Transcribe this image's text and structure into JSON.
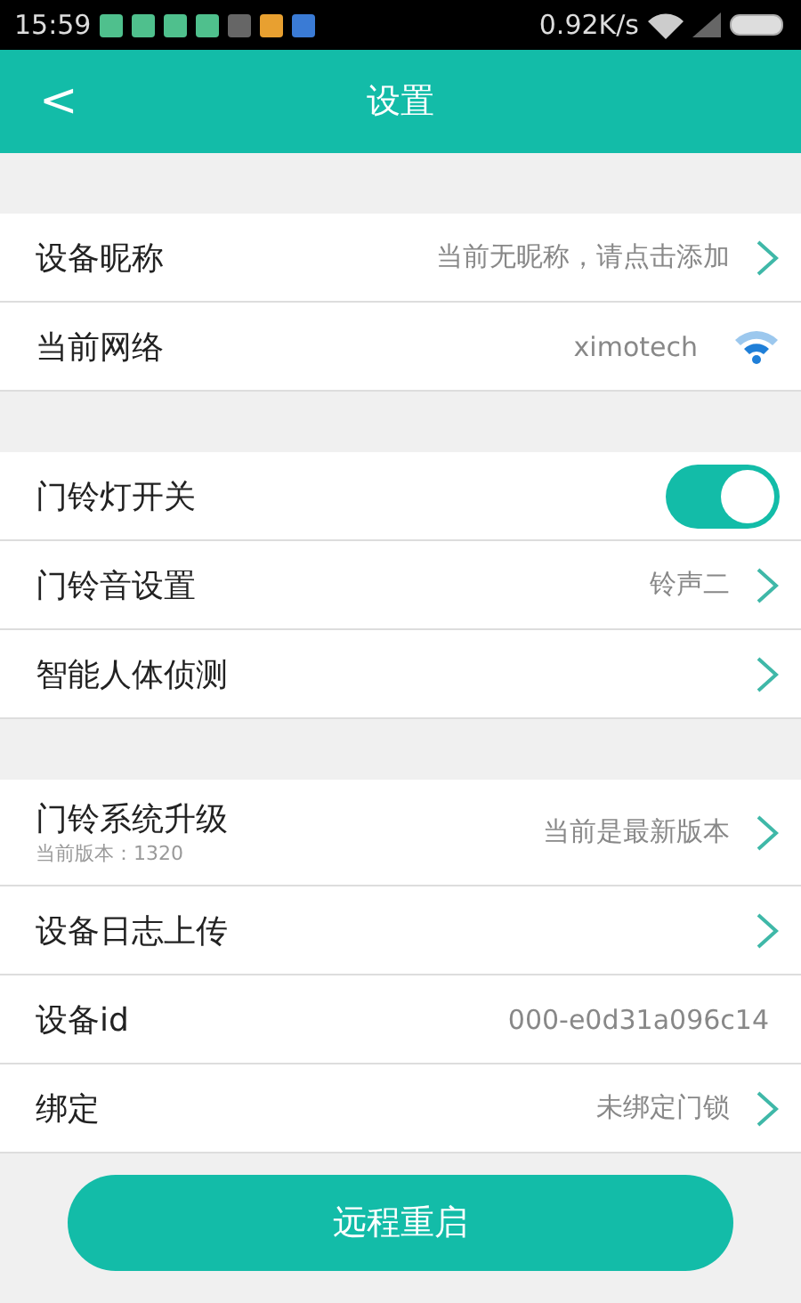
{
  "status_bar": {
    "time": "15:59",
    "speed": "0.92K/s"
  },
  "header": {
    "back": "<",
    "title": "设置"
  },
  "groups": [
    {
      "rows": [
        {
          "kind": "nav",
          "label": "设备昵称",
          "value": "当前无昵称，请点击添加"
        },
        {
          "kind": "network",
          "label": "当前网络",
          "value": "ximotech"
        }
      ]
    },
    {
      "rows": [
        {
          "kind": "switch",
          "label": "门铃灯开关",
          "on": true
        },
        {
          "kind": "nav",
          "label": "门铃音设置",
          "value": "铃声二"
        },
        {
          "kind": "nav",
          "label": "智能人体侦测"
        }
      ]
    },
    {
      "rows": [
        {
          "kind": "nav",
          "label": "门铃系统升级",
          "sub": "当前版本：1320",
          "value": "当前是最新版本"
        },
        {
          "kind": "nav",
          "label": "设备日志上传"
        },
        {
          "kind": "info",
          "label": "设备id",
          "value": "000-e0d31a096c14"
        },
        {
          "kind": "nav",
          "label": "绑定",
          "value": "未绑定门锁"
        }
      ]
    }
  ],
  "button": {
    "label": "远程重启"
  }
}
